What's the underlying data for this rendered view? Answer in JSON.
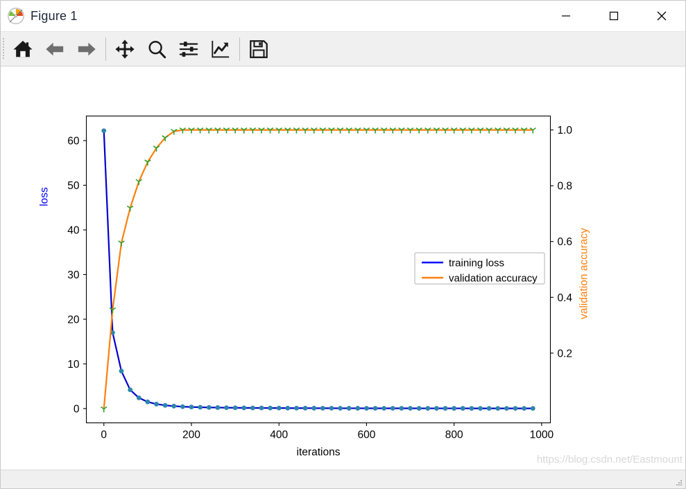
{
  "window": {
    "title": "Figure 1",
    "icon": "matplotlib-logo-icon",
    "minimize_label": "—",
    "maximize_label": "☐",
    "close_label": "✕"
  },
  "toolbar": {
    "buttons": [
      {
        "name": "home-icon",
        "tooltip": "Reset original view"
      },
      {
        "name": "back-arrow-icon",
        "tooltip": "Back to previous view"
      },
      {
        "name": "forward-arrow-icon",
        "tooltip": "Forward to next view"
      },
      {
        "name": "pan-move-icon",
        "tooltip": "Pan axes with left mouse, zoom with right"
      },
      {
        "name": "zoom-magnifier-icon",
        "tooltip": "Zoom to rectangle"
      },
      {
        "name": "configure-subplots-sliders-icon",
        "tooltip": "Configure subplots"
      },
      {
        "name": "edit-axis-curve-icon",
        "tooltip": "Edit axis, curve and image parameters"
      },
      {
        "name": "save-floppy-icon",
        "tooltip": "Save the figure"
      }
    ]
  },
  "statusbar": {
    "watermark": "https://blog.csdn.net/Eastmount"
  },
  "chart_data": {
    "type": "line",
    "title": "",
    "xlabel": "iterations",
    "ylabel": "loss",
    "y2label": "validation accuracy",
    "xlim": [
      -40,
      1020
    ],
    "ylim": [
      -3.2,
      65.5
    ],
    "y2lim": [
      -0.05,
      1.05
    ],
    "xticks": [
      0,
      200,
      400,
      600,
      800,
      1000
    ],
    "xticklabels": [
      "0",
      "200",
      "400",
      "600",
      "800",
      "1000"
    ],
    "yticks": [
      0,
      10,
      20,
      30,
      40,
      50,
      60
    ],
    "yticklabels": [
      "0",
      "10",
      "20",
      "30",
      "40",
      "50",
      "60"
    ],
    "y2ticks": [
      0.2,
      0.4,
      0.6,
      0.8,
      1.0
    ],
    "y2ticklabels": [
      "0.2",
      "0.4",
      "0.6",
      "0.8",
      "1.0"
    ],
    "grid": false,
    "legend_position": "center right",
    "ylabel_color": "#0000ff",
    "y2label_color": "#ff7f0e",
    "series": [
      {
        "name": "training loss",
        "axis": "left",
        "color": "#0000cd",
        "marker": "o",
        "marker_color": "#2e86ab",
        "x": [
          0,
          20,
          40,
          60,
          80,
          100,
          120,
          140,
          160,
          180,
          200,
          220,
          240,
          260,
          280,
          300,
          320,
          340,
          360,
          380,
          400,
          420,
          440,
          460,
          480,
          500,
          520,
          540,
          560,
          580,
          600,
          620,
          640,
          660,
          680,
          700,
          720,
          740,
          760,
          780,
          800,
          820,
          840,
          860,
          880,
          900,
          920,
          940,
          960,
          980
        ],
        "values": [
          62.2,
          17.0,
          8.4,
          4.2,
          2.4,
          1.5,
          1.0,
          0.72,
          0.55,
          0.43,
          0.35,
          0.29,
          0.25,
          0.22,
          0.19,
          0.17,
          0.15,
          0.14,
          0.13,
          0.12,
          0.11,
          0.1,
          0.095,
          0.09,
          0.085,
          0.08,
          0.075,
          0.07,
          0.068,
          0.065,
          0.062,
          0.06,
          0.058,
          0.056,
          0.054,
          0.052,
          0.05,
          0.048,
          0.047,
          0.046,
          0.045,
          0.044,
          0.043,
          0.042,
          0.041,
          0.04,
          0.039,
          0.038,
          0.037,
          0.036
        ]
      },
      {
        "name": "validation accuracy",
        "axis": "right",
        "color": "#ff7f0e",
        "marker": "1",
        "marker_color": "#2ca02c",
        "x": [
          0,
          20,
          40,
          60,
          80,
          100,
          120,
          140,
          160,
          180,
          200,
          220,
          240,
          260,
          280,
          300,
          320,
          340,
          360,
          380,
          400,
          420,
          440,
          460,
          480,
          500,
          520,
          540,
          560,
          580,
          600,
          620,
          640,
          660,
          680,
          700,
          720,
          740,
          760,
          780,
          800,
          820,
          840,
          860,
          880,
          900,
          920,
          940,
          960,
          980
        ],
        "values": [
          0.0,
          0.355,
          0.595,
          0.72,
          0.815,
          0.885,
          0.935,
          0.972,
          0.995,
          1.0,
          1.0,
          1.0,
          1.0,
          1.0,
          1.0,
          1.0,
          1.0,
          1.0,
          1.0,
          1.0,
          1.0,
          1.0,
          1.0,
          1.0,
          1.0,
          1.0,
          1.0,
          1.0,
          1.0,
          1.0,
          1.0,
          1.0,
          1.0,
          1.0,
          1.0,
          1.0,
          1.0,
          1.0,
          1.0,
          1.0,
          1.0,
          1.0,
          1.0,
          1.0,
          1.0,
          1.0,
          1.0,
          1.0,
          1.0,
          1.0
        ]
      }
    ],
    "legend": [
      {
        "label": "training loss",
        "color": "#0000ff"
      },
      {
        "label": "validation accuracy",
        "color": "#ff7f0e"
      }
    ]
  }
}
